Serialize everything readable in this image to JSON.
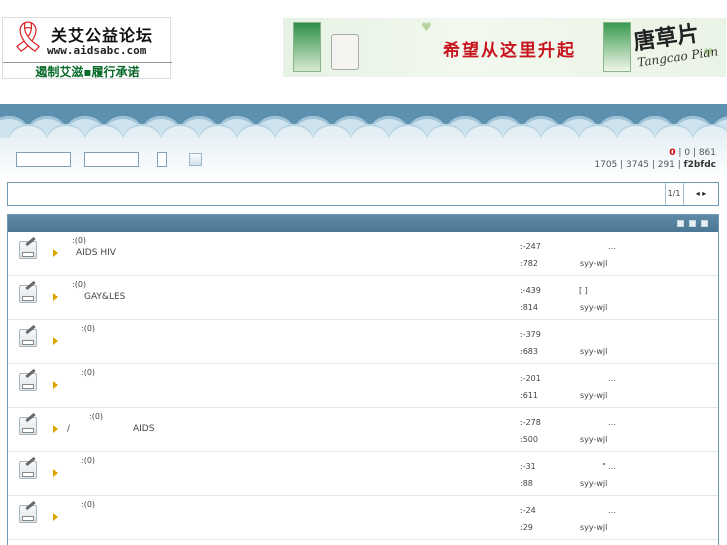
{
  "header": {
    "logo": {
      "ribbon_icon": "red-ribbon-icon",
      "name": "关艾公益论坛",
      "url": "www.aidsabc.com",
      "slogan": "遏制艾滋▪履行承诺"
    },
    "banner": {
      "headline": "希望从这里升起",
      "brand": "唐草片",
      "brand_en": "Tangcao Pian"
    }
  },
  "stats": {
    "row1": {
      "a": "0",
      "b": "0",
      "c": "861"
    },
    "row2": {
      "a": "1705",
      "b": "3745",
      "c": "291",
      "user": "f2bfdc"
    }
  },
  "pager": {
    "page": "1/1",
    "nav": "◂ ▸"
  },
  "forums": [
    {
      "count": ":(0)",
      "desc": "AIDS   HIV",
      "stat_topics": ":-247",
      "stat_posts": ":782",
      "last_title": "...",
      "last_user": "syy-wjl"
    },
    {
      "count": ":(0)",
      "desc": "GAY&LES",
      "stat_topics": ":-439",
      "stat_posts": ":814",
      "last_title": "[ ]",
      "last_user": "syy-wjl"
    },
    {
      "count": ":(0)",
      "desc": "",
      "stat_topics": ":-379",
      "stat_posts": ":683",
      "last_title": "",
      "last_user": "syy-wjl"
    },
    {
      "count": ":(0)",
      "desc": "",
      "stat_topics": ":-201",
      "stat_posts": ":611",
      "last_title": "...",
      "last_user": "syy-wjl"
    },
    {
      "count": ":(0)",
      "desc": "/                      AIDS",
      "stat_topics": ":-278",
      "stat_posts": ":500",
      "last_title": "...",
      "last_user": "syy-wjl"
    },
    {
      "count": ":(0)",
      "desc": "",
      "stat_topics": ":-31",
      "stat_posts": ":88",
      "last_title": "\" ...",
      "last_user": "syy-wjl"
    },
    {
      "count": ":(0)",
      "desc": "",
      "stat_topics": ":-24",
      "stat_posts": ":29",
      "last_title": "...",
      "last_user": "syy-wjl"
    }
  ]
}
